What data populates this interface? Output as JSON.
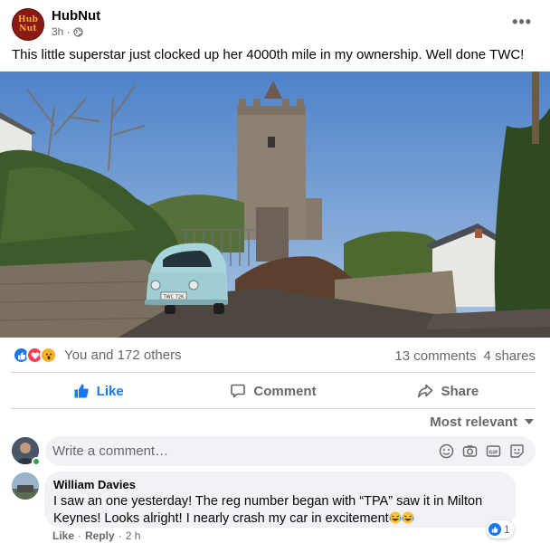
{
  "post": {
    "author": "HubNut",
    "logo_line1": "Hub",
    "logo_line2": "Nut",
    "time": "3h ·",
    "more_label": "•••",
    "text": "This little superstar just clocked up her 4000th mile in my ownership. Well done TWC!",
    "photo": {
      "plate": "TWC 72K"
    }
  },
  "engagement": {
    "reactions_text": "You and 172 others",
    "comments": "13 comments",
    "shares": "4 shares"
  },
  "actions": {
    "like_label": "Like",
    "comment_label": "Comment",
    "share_label": "Share"
  },
  "sort": {
    "label": "Most relevant"
  },
  "composer": {
    "placeholder": "Write a comment…"
  },
  "comments": [
    {
      "name": "William Davies",
      "text": "I saw an one yesterday! The reg number began with “TPA” saw it in Milton Keynes! Looks alright! I nearly crash my car in excitement",
      "reaction_count": "1",
      "like_label": "Like",
      "reply_label": "Reply",
      "time": "2 h"
    }
  ],
  "colors": {
    "accent": "#1877f2",
    "text": "#050505",
    "muted": "#65676b",
    "surface": "#f0f2f5"
  }
}
